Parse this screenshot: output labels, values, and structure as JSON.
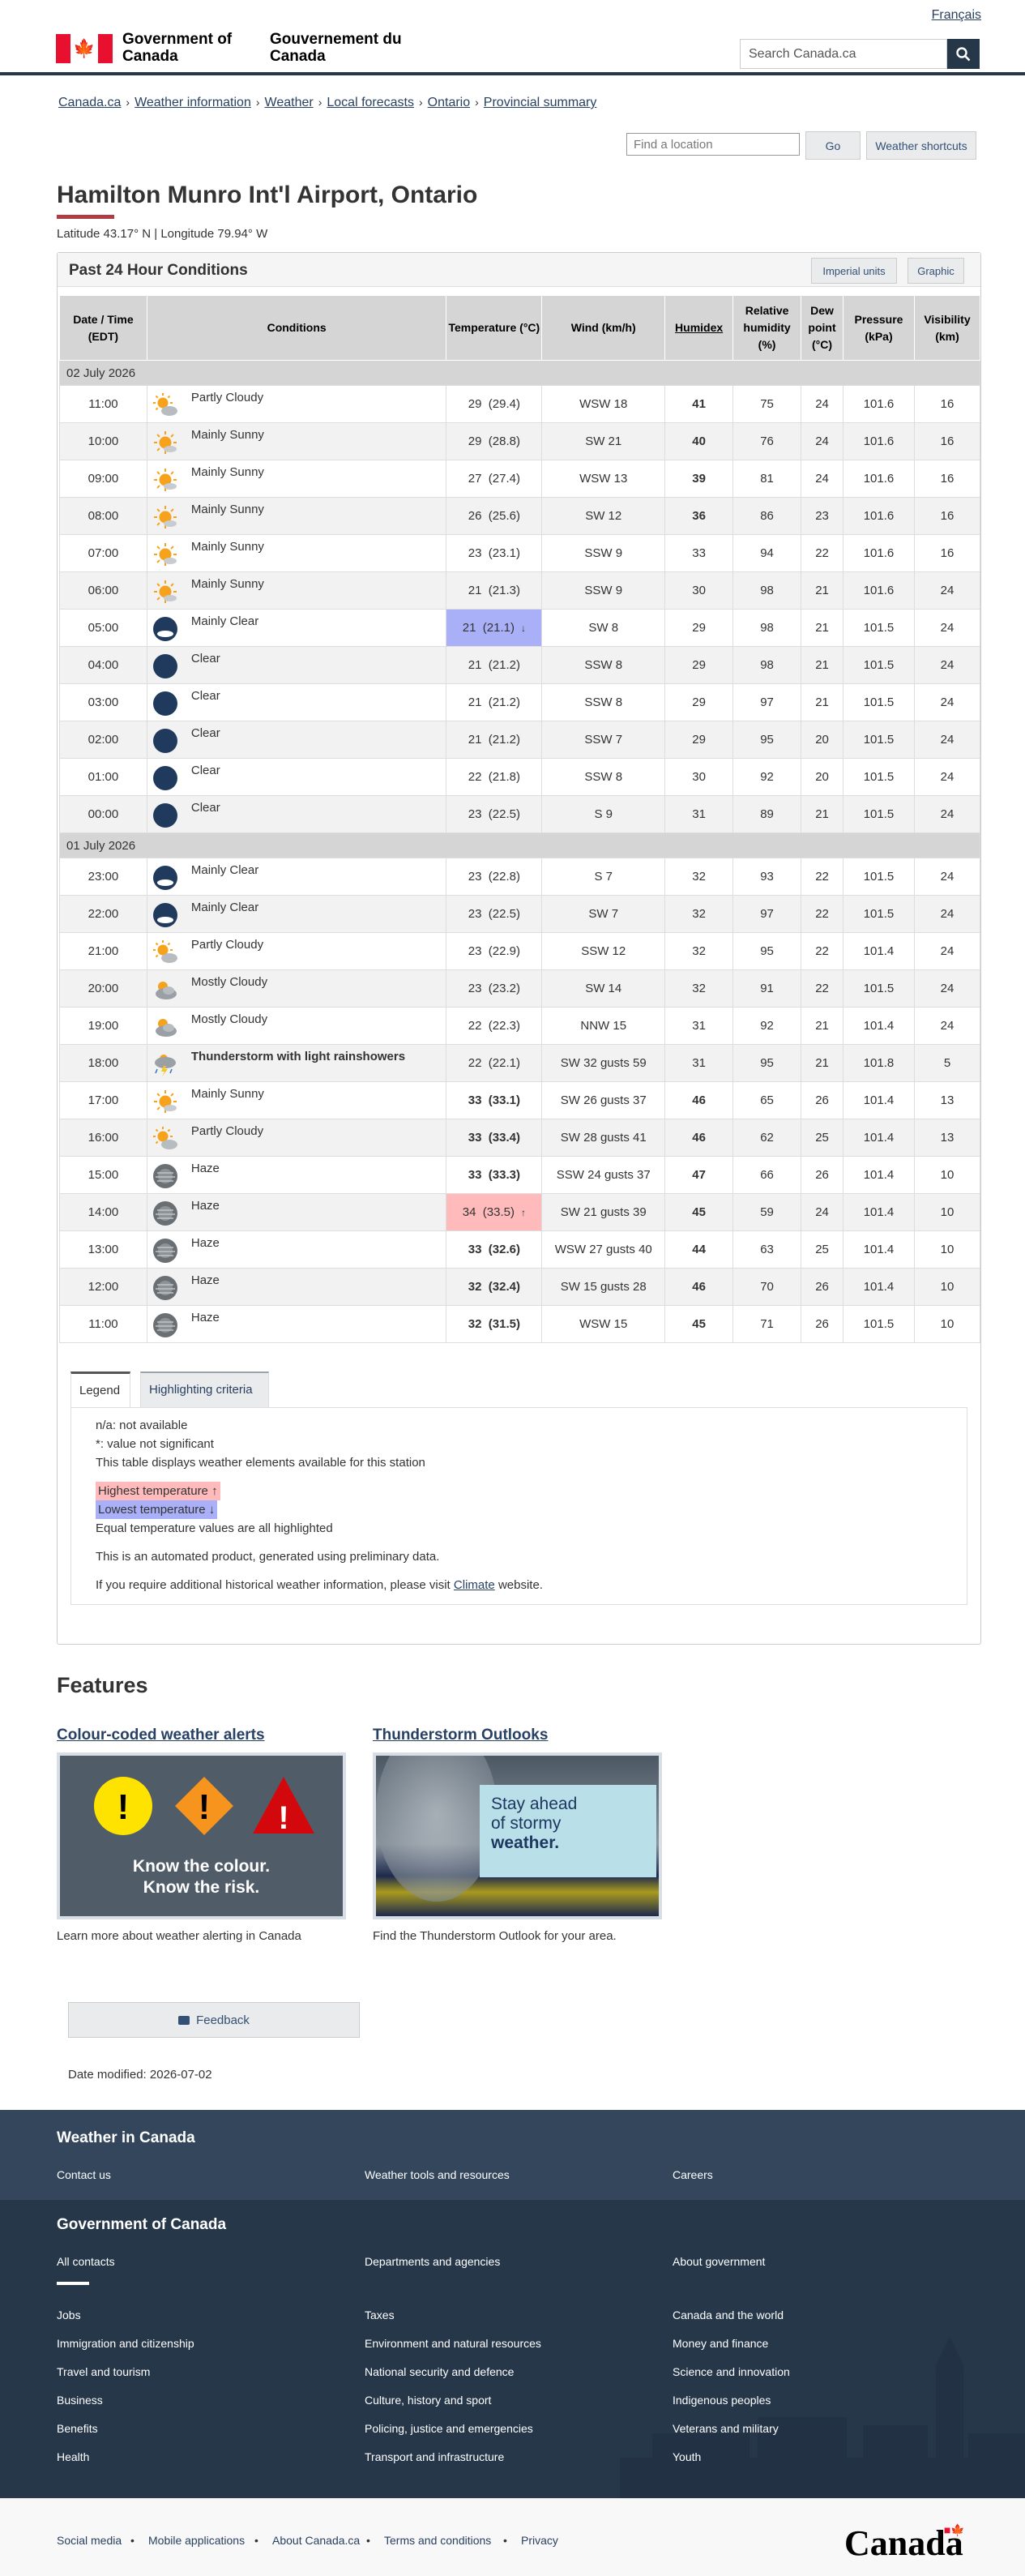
{
  "header": {
    "lang_link": "Français",
    "sig_en": "Government of Canada",
    "sig_fr": "Gouvernement du Canada",
    "search_placeholder": "Search Canada.ca",
    "colors": {
      "primary": "#26374a",
      "flag_red": "#e8102e",
      "accent_bar": "#af3c43"
    }
  },
  "breadcrumb": [
    "Canada.ca",
    "Weather information",
    "Weather",
    "Local forecasts",
    "Ontario",
    "Provincial summary"
  ],
  "toolbar": {
    "find_placeholder": "Find a location",
    "go_label": "Go",
    "shortcuts_label": "Weather shortcuts"
  },
  "page": {
    "title": "Hamilton Munro Int'l Airport, Ontario",
    "latlon": "Latitude 43.17° N | Longitude 79.94° W"
  },
  "panel": {
    "title": "Past 24 Hour Conditions",
    "imperial_label": "Imperial units",
    "graphic_label": "Graphic"
  },
  "table": {
    "headers": [
      "Date / Time (EDT)",
      "Conditions",
      "Temperature (°C)",
      "Wind (km/h)",
      "Humidex",
      "Relative humidity (%)",
      "Dew point (°C)",
      "Pressure (kPa)",
      "Visibility (km)"
    ],
    "groups": [
      {
        "date": "02 July 2026",
        "rows": [
          {
            "time": "11:00",
            "icon": "partly-cloudy-day-icon",
            "cond": "Partly Cloudy",
            "temp": "29  (29.4)",
            "wind": "WSW 18",
            "humidex": "41",
            "hx_bold": true,
            "rh": "75",
            "dew": "24",
            "press": "101.6",
            "vis": "16"
          },
          {
            "time": "10:00",
            "icon": "sunny-icon",
            "cond": "Mainly Sunny",
            "temp": "29  (28.8)",
            "wind": "SW 21",
            "humidex": "40",
            "hx_bold": true,
            "rh": "76",
            "dew": "24",
            "press": "101.6",
            "vis": "16"
          },
          {
            "time": "09:00",
            "icon": "sunny-icon",
            "cond": "Mainly Sunny",
            "temp": "27  (27.4)",
            "wind": "WSW 13",
            "humidex": "39",
            "hx_bold": true,
            "rh": "81",
            "dew": "24",
            "press": "101.6",
            "vis": "16"
          },
          {
            "time": "08:00",
            "icon": "sunny-icon",
            "cond": "Mainly Sunny",
            "temp": "26  (25.6)",
            "wind": "SW 12",
            "humidex": "36",
            "hx_bold": true,
            "rh": "86",
            "dew": "23",
            "press": "101.6",
            "vis": "16"
          },
          {
            "time": "07:00",
            "icon": "sunny-icon",
            "cond": "Mainly Sunny",
            "temp": "23  (23.1)",
            "wind": "SSW 9",
            "humidex": "33",
            "rh": "94",
            "dew": "22",
            "press": "101.6",
            "vis": "16"
          },
          {
            "time": "06:00",
            "icon": "sunny-icon",
            "cond": "Mainly Sunny",
            "temp": "21  (21.3)",
            "wind": "SSW 9",
            "humidex": "30",
            "rh": "98",
            "dew": "21",
            "press": "101.6",
            "vis": "24"
          },
          {
            "time": "05:00",
            "icon": "mainly-clear-night-icon",
            "cond": "Mainly Clear",
            "temp": "21  (21.1)",
            "temp_mark": "lo",
            "wind": "SW 8",
            "humidex": "29",
            "rh": "98",
            "dew": "21",
            "press": "101.5",
            "vis": "24"
          },
          {
            "time": "04:00",
            "icon": "clear-night-icon",
            "cond": "Clear",
            "temp": "21  (21.2)",
            "wind": "SSW 8",
            "humidex": "29",
            "rh": "98",
            "dew": "21",
            "press": "101.5",
            "vis": "24"
          },
          {
            "time": "03:00",
            "icon": "clear-night-icon",
            "cond": "Clear",
            "temp": "21  (21.2)",
            "wind": "SSW 8",
            "humidex": "29",
            "rh": "97",
            "dew": "21",
            "press": "101.5",
            "vis": "24"
          },
          {
            "time": "02:00",
            "icon": "clear-night-icon",
            "cond": "Clear",
            "temp": "21  (21.2)",
            "wind": "SSW 7",
            "humidex": "29",
            "rh": "95",
            "dew": "20",
            "press": "101.5",
            "vis": "24"
          },
          {
            "time": "01:00",
            "icon": "clear-night-icon",
            "cond": "Clear",
            "temp": "22  (21.8)",
            "wind": "SSW 8",
            "humidex": "30",
            "rh": "92",
            "dew": "20",
            "press": "101.5",
            "vis": "24"
          },
          {
            "time": "00:00",
            "icon": "clear-night-icon",
            "cond": "Clear",
            "temp": "23  (22.5)",
            "wind": "S 9",
            "humidex": "31",
            "rh": "89",
            "dew": "21",
            "press": "101.5",
            "vis": "24"
          }
        ]
      },
      {
        "date": "01 July 2026",
        "rows": [
          {
            "time": "23:00",
            "icon": "mainly-clear-night-icon",
            "cond": "Mainly Clear",
            "temp": "23  (22.8)",
            "wind": "S 7",
            "humidex": "32",
            "rh": "93",
            "dew": "22",
            "press": "101.5",
            "vis": "24"
          },
          {
            "time": "22:00",
            "icon": "mainly-clear-night-icon",
            "cond": "Mainly Clear",
            "temp": "23  (22.5)",
            "wind": "SW 7",
            "humidex": "32",
            "rh": "97",
            "dew": "22",
            "press": "101.5",
            "vis": "24"
          },
          {
            "time": "21:00",
            "icon": "partly-cloudy-day-icon",
            "cond": "Partly Cloudy",
            "temp": "23  (22.9)",
            "wind": "SSW 12",
            "humidex": "32",
            "rh": "95",
            "dew": "22",
            "press": "101.4",
            "vis": "24"
          },
          {
            "time": "20:00",
            "icon": "mostly-cloudy-icon",
            "cond": "Mostly Cloudy",
            "temp": "23  (23.2)",
            "wind": "SW 14",
            "humidex": "32",
            "rh": "91",
            "dew": "22",
            "press": "101.5",
            "vis": "24"
          },
          {
            "time": "19:00",
            "icon": "mostly-cloudy-icon",
            "cond": "Mostly Cloudy",
            "temp": "22  (22.3)",
            "wind": "NNW 15",
            "humidex": "31",
            "rh": "92",
            "dew": "21",
            "press": "101.4",
            "vis": "24"
          },
          {
            "time": "18:00",
            "icon": "thunderstorm-icon",
            "cond": "Thunderstorm with light rainshowers",
            "cond_bold": true,
            "temp": "22  (22.1)",
            "wind": "SW 32 gusts 59",
            "humidex": "31",
            "rh": "95",
            "dew": "21",
            "press": "101.8",
            "vis": "5"
          },
          {
            "time": "17:00",
            "icon": "sunny-icon",
            "cond": "Mainly Sunny",
            "temp": "33  (33.1)",
            "temp_bold": true,
            "wind": "SW 26 gusts 37",
            "humidex": "46",
            "hx_bold": true,
            "rh": "65",
            "dew": "26",
            "press": "101.4",
            "vis": "13"
          },
          {
            "time": "16:00",
            "icon": "partly-cloudy-day-icon",
            "cond": "Partly Cloudy",
            "temp": "33  (33.4)",
            "temp_bold": true,
            "wind": "SW 28 gusts 41",
            "humidex": "46",
            "hx_bold": true,
            "rh": "62",
            "dew": "25",
            "press": "101.4",
            "vis": "13"
          },
          {
            "time": "15:00",
            "icon": "haze-icon",
            "cond": "Haze",
            "temp": "33  (33.3)",
            "temp_bold": true,
            "wind": "SSW 24 gusts 37",
            "humidex": "47",
            "hx_bold": true,
            "rh": "66",
            "dew": "26",
            "press": "101.4",
            "vis": "10"
          },
          {
            "time": "14:00",
            "icon": "haze-icon",
            "cond": "Haze",
            "temp": "34  (33.5)",
            "temp_mark": "hi",
            "wind": "SW 21 gusts 39",
            "humidex": "45",
            "hx_bold": true,
            "rh": "59",
            "dew": "24",
            "press": "101.4",
            "vis": "10"
          },
          {
            "time": "13:00",
            "icon": "haze-icon",
            "cond": "Haze",
            "temp": "33  (32.6)",
            "temp_bold": true,
            "wind": "WSW 27 gusts 40",
            "humidex": "44",
            "hx_bold": true,
            "rh": "63",
            "dew": "25",
            "press": "101.4",
            "vis": "10"
          },
          {
            "time": "12:00",
            "icon": "haze-icon",
            "cond": "Haze",
            "temp": "32  (32.4)",
            "temp_bold": true,
            "wind": "SW 15 gusts 28",
            "humidex": "46",
            "hx_bold": true,
            "rh": "70",
            "dew": "26",
            "press": "101.4",
            "vis": "10"
          },
          {
            "time": "11:00",
            "icon": "haze-icon",
            "cond": "Haze",
            "temp": "32  (31.5)",
            "temp_bold": true,
            "wind": "WSW 15",
            "humidex": "45",
            "hx_bold": true,
            "rh": "71",
            "dew": "26",
            "press": "101.5",
            "vis": "10"
          }
        ]
      }
    ]
  },
  "legend": {
    "tab_legend": "Legend",
    "tab_criteria": "Highlighting criteria",
    "line1": "n/a: not available",
    "line2": "*: value not significant",
    "line3": "This table displays weather elements available for this station",
    "highest": "Highest temperature",
    "lowest": "Lowest temperature",
    "equal": "Equal temperature values are all highlighted",
    "automated": "This is an automated product, generated using preliminary data.",
    "historical_pre": "If you require additional historical weather information, please visit",
    "historical_link": "Climate",
    "historical_post": "website."
  },
  "features": {
    "heading": "Features",
    "cards": [
      {
        "title": "Colour-coded weather alerts",
        "img_text_1": "Know the colour.",
        "img_text_2": "Know the risk.",
        "desc": "Learn more about weather alerting in Canada"
      },
      {
        "title": "Thunderstorm Outlooks",
        "img_text_1": "Stay ahead",
        "img_text_2": "of stormy",
        "img_text_3": "weather.",
        "desc": "Find the Thunderstorm Outlook for your area."
      }
    ]
  },
  "feedback_label": "Feedback",
  "date_modified": "Date modified: 2026-07-02",
  "footer": {
    "weather_title": "Weather in Canada",
    "weather_links": [
      "Contact us",
      "Weather tools and resources",
      "Careers"
    ],
    "gov_title": "Government of Canada",
    "gov_top": [
      "All contacts",
      "Departments and agencies",
      "About government"
    ],
    "gov_col1": [
      "Jobs",
      "Immigration and citizenship",
      "Travel and tourism",
      "Business",
      "Benefits",
      "Health"
    ],
    "gov_col2": [
      "Taxes",
      "Environment and natural resources",
      "National security and defence",
      "Culture, history and sport",
      "Policing, justice and emergencies",
      "Transport and infrastructure"
    ],
    "gov_col3": [
      "Canada and the world",
      "Money and finance",
      "Science and innovation",
      "Indigenous peoples",
      "Veterans and military",
      "Youth"
    ],
    "bottom_links": [
      "Social media",
      "Mobile applications",
      "About Canada.ca",
      "Terms and conditions",
      "Privacy"
    ],
    "wordmark": "Canada"
  }
}
